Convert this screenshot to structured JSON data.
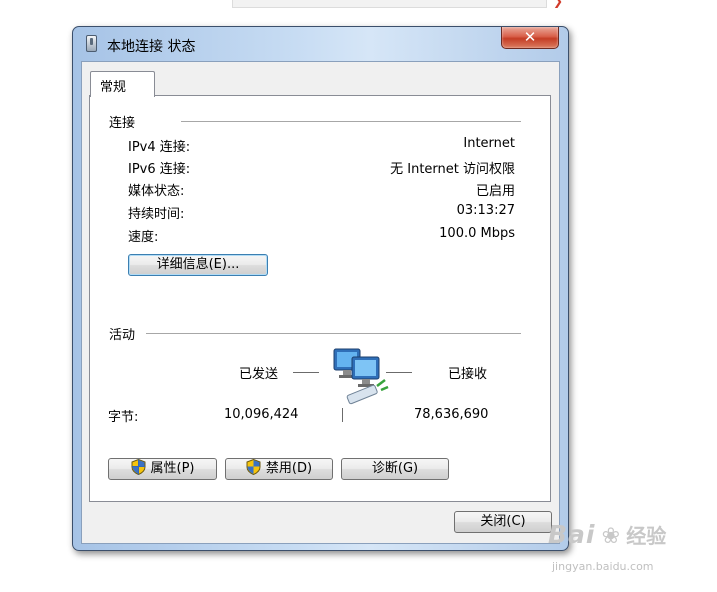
{
  "dialog": {
    "title": "本地连接 状态",
    "close_glyph": "✕",
    "tab": "常规"
  },
  "connection": {
    "heading": "连接",
    "rows": [
      {
        "label": "IPv4 连接:",
        "value": "Internet"
      },
      {
        "label": "IPv6 连接:",
        "value": "无 Internet 访问权限"
      },
      {
        "label": "媒体状态:",
        "value": "已启用"
      },
      {
        "label": "持续时间:",
        "value": "03:13:27"
      },
      {
        "label": "速度:",
        "value": "100.0 Mbps"
      }
    ],
    "details_button": "详细信息(E)..."
  },
  "activity": {
    "heading": "活动",
    "sent_label": "已发送",
    "received_label": "已接收",
    "bytes_label": "字节:",
    "bytes_sent": "10,096,424",
    "bytes_received": "78,636,690"
  },
  "buttons": {
    "properties": "属性(P)",
    "disable": "禁用(D)",
    "diagnose": "诊断(G)",
    "close": "关闭(C)"
  },
  "icons": {
    "title": "network-adapter-icon",
    "activity": "network-computers-icon",
    "shield": "uac-shield-icon"
  },
  "watermark": {
    "brand": "Bai",
    "suffix": "经验",
    "url": "jingyan.baidu.com"
  },
  "colors": {
    "frame": "#b9d1ea",
    "close_button": "#c43d25",
    "panel": "#ffffff"
  }
}
